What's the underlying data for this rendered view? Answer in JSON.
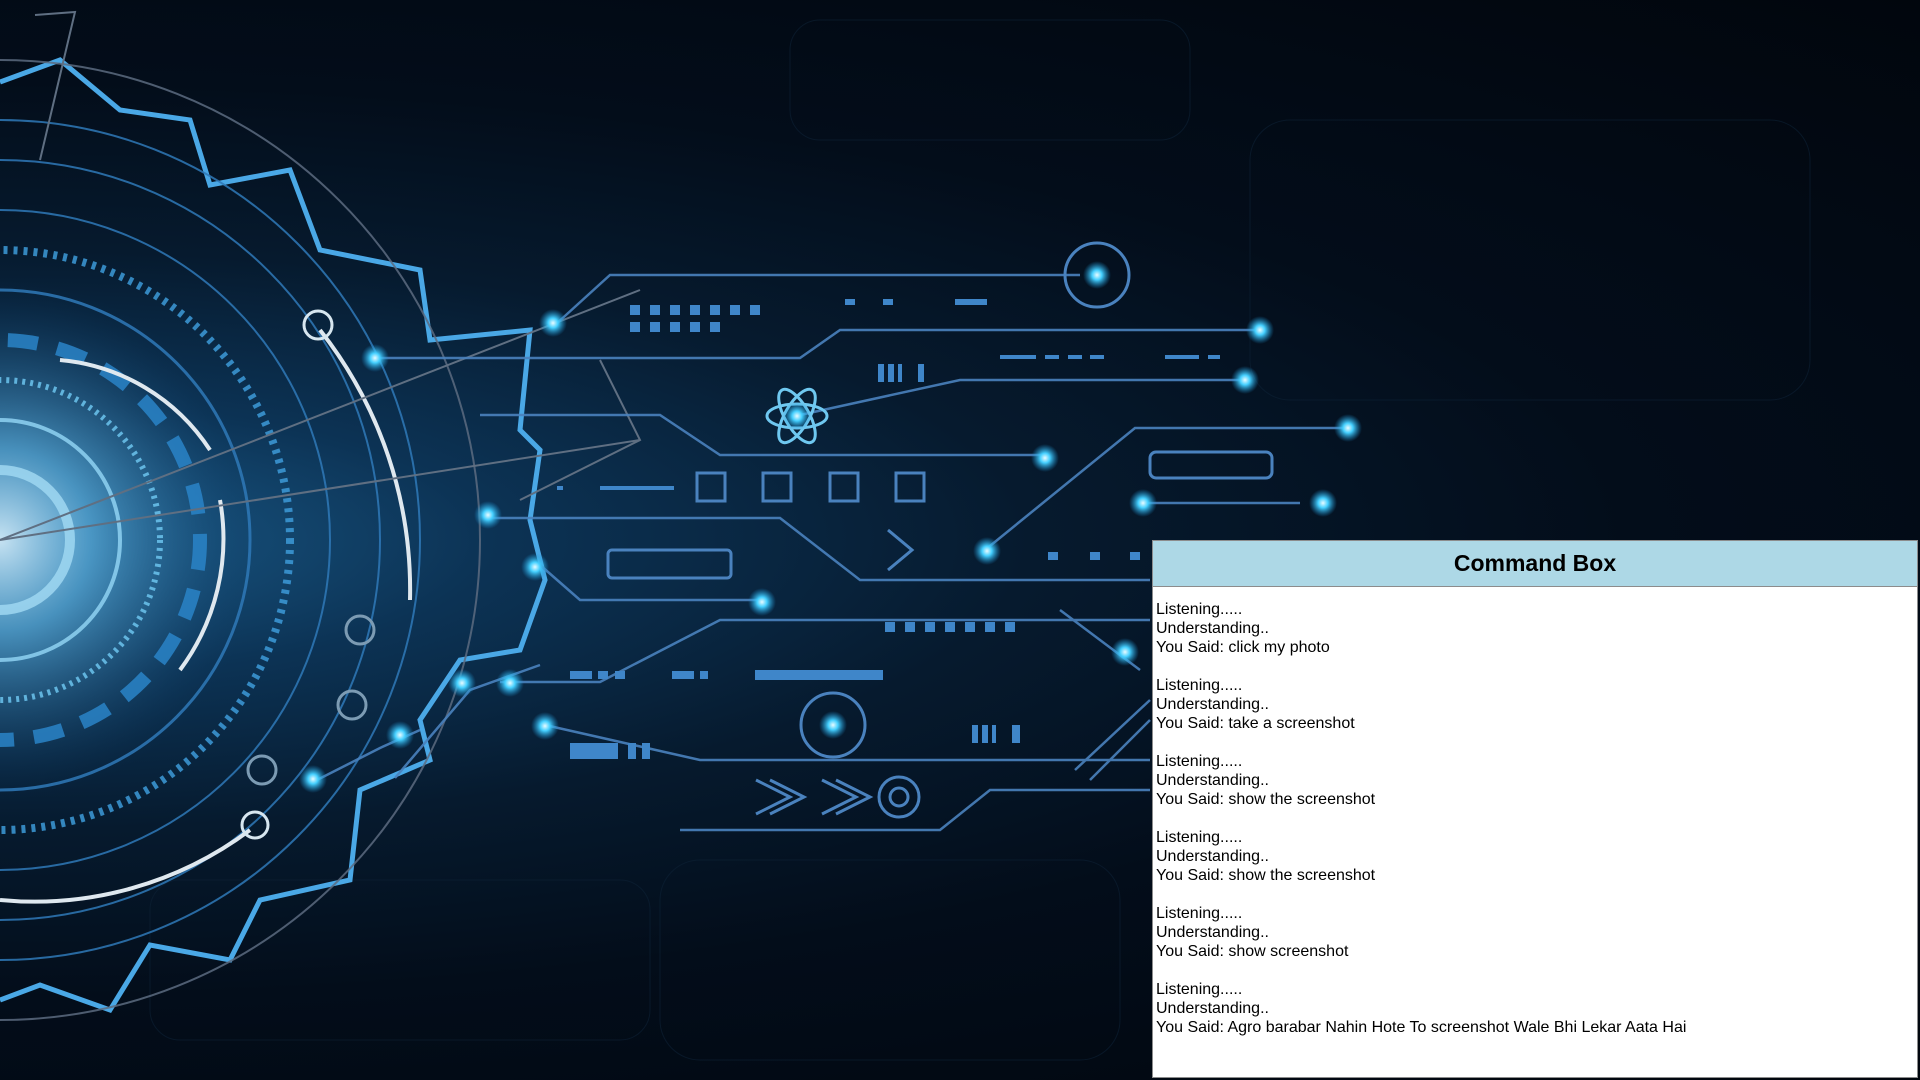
{
  "wallpaper": {
    "theme": "blue technology gear circuit background",
    "accent_color": "#3fc3ff",
    "line_color": "#4a8fd0",
    "background_color": "#020a14"
  },
  "command_box": {
    "title": "Command Box",
    "header_color": "#add8e6",
    "entries": [
      {
        "listening": "Listening.....",
        "understanding": "Understanding..",
        "said": "You Said: click my photo"
      },
      {
        "listening": "Listening.....",
        "understanding": "Understanding..",
        "said": "You Said: take a screenshot"
      },
      {
        "listening": "Listening.....",
        "understanding": "Understanding..",
        "said": "You Said: show the screenshot"
      },
      {
        "listening": "Listening.....",
        "understanding": "Understanding..",
        "said": "You Said: show the screenshot"
      },
      {
        "listening": "Listening.....",
        "understanding": "Understanding..",
        "said": "You Said: show screenshot"
      },
      {
        "listening": "Listening.....",
        "understanding": "Understanding..",
        "said": "You Said: Agro barabar Nahin Hote To screenshot Wale Bhi Lekar Aata Hai"
      }
    ]
  }
}
